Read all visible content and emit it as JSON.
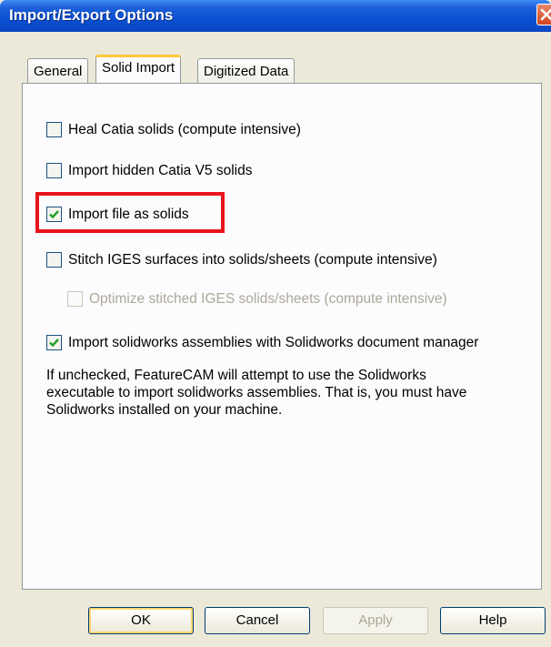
{
  "window": {
    "title": "Import/Export Options"
  },
  "tabs": [
    {
      "label": "General",
      "active": false
    },
    {
      "label": "Solid Import",
      "active": true
    },
    {
      "label": "Digitized Data",
      "active": false
    }
  ],
  "options": [
    {
      "label": "Heal Catia solids (compute intensive)",
      "checked": false,
      "enabled": true
    },
    {
      "label": "Import hidden Catia V5 solids",
      "checked": false,
      "enabled": true
    },
    {
      "label": "Import file as solids",
      "checked": true,
      "enabled": true,
      "highlighted": true
    },
    {
      "label": "Stitch IGES surfaces into solids/sheets (compute intensive)",
      "checked": false,
      "enabled": true
    },
    {
      "label": "Optimize stitched IGES solids/sheets (compute intensive)",
      "checked": false,
      "enabled": false
    },
    {
      "label": "Import solidworks assemblies with Solidworks document manager",
      "checked": true,
      "enabled": true
    }
  ],
  "info_lines": [
    "If unchecked, FeatureCAM will attempt to use the Solidworks",
    "executable to import solidworks assemblies. That is, you must have",
    "Solidworks installed on your machine."
  ],
  "buttons": {
    "ok": "OK",
    "cancel": "Cancel",
    "apply": "Apply",
    "help": "Help"
  },
  "colors": {
    "highlight": "#e8141b",
    "titlebar": "#0a4fd2",
    "checkmark": "#21a121"
  },
  "icons": {
    "close": "close-icon",
    "check": "checkmark-icon"
  }
}
